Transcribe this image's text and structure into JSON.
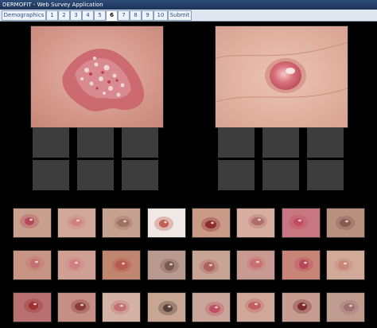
{
  "window": {
    "title": "DERMOFIT - Web Survey Application"
  },
  "tabs": [
    {
      "label": "Demographics"
    },
    {
      "label": "1"
    },
    {
      "label": "2"
    },
    {
      "label": "3"
    },
    {
      "label": "4"
    },
    {
      "label": "5"
    },
    {
      "label": "6",
      "active": true
    },
    {
      "label": "7"
    },
    {
      "label": "8"
    },
    {
      "label": "9"
    },
    {
      "label": "10"
    },
    {
      "label": "Submit"
    }
  ],
  "query_images": [
    {
      "name": "query-lesion-left",
      "kind": "scaly-patch"
    },
    {
      "name": "query-lesion-right",
      "kind": "nodule"
    }
  ],
  "answer_slots": {
    "per_group": 6,
    "groups": 2
  },
  "candidate_thumbnails": {
    "rows": 3,
    "cols": 8,
    "tones": [
      [
        "#c9a08e",
        "#d2a89a",
        "#c7a190",
        "#f0e8e4",
        "#c99a86",
        "#d7aea0",
        "#c67780",
        "#b89080"
      ],
      [
        "#c89484",
        "#d0a094",
        "#c0856e",
        "#b89a90",
        "#c8a494",
        "#c99a92",
        "#c98478",
        "#d1aa9a"
      ],
      [
        "#b87070",
        "#c49086",
        "#d4b2a6",
        "#c7a694",
        "#caa59a",
        "#cfa89a",
        "#c69d90",
        "#bf9c90"
      ]
    ],
    "lesions": [
      [
        "#b4485a",
        "#cf8080",
        "#a07060",
        "#c06050",
        "#8a2c2c",
        "#b06c6c",
        "#c44a60",
        "#8a5a52"
      ],
      [
        "#c47070",
        "#d08080",
        "#b85a50",
        "#7a5a50",
        "#b06060",
        "#c97070",
        "#b84858",
        "#c78878"
      ],
      [
        "#9a3030",
        "#8c3a3a",
        "#c27070",
        "#5a4038",
        "#c05060",
        "#c06060",
        "#7a2a30",
        "#a07070"
      ]
    ]
  }
}
